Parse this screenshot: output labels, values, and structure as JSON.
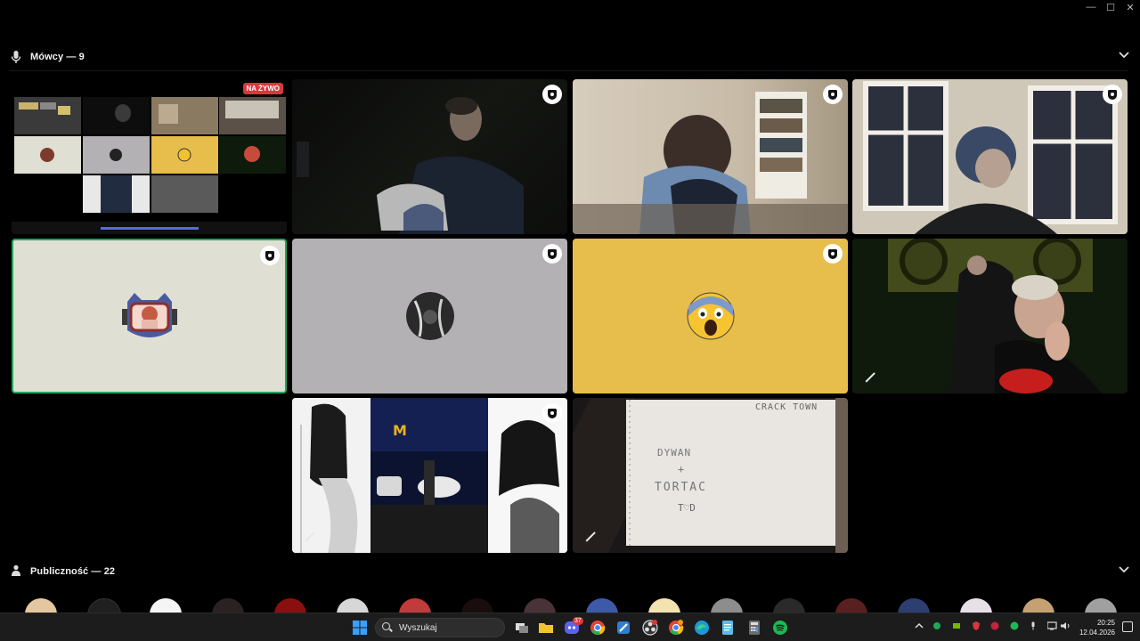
{
  "window": {
    "minimize": "—",
    "maximize": "☐",
    "close": "✕"
  },
  "speakers": {
    "title": "Mówcy — 9",
    "icon": "microphone-icon",
    "collapse_icon": "chevron-down-icon"
  },
  "live_badge": "NA ŻYWO",
  "tiles": [
    {
      "id": "stream-screen",
      "kind": "stream"
    },
    {
      "id": "cam-dark-room",
      "kind": "camera"
    },
    {
      "id": "cam-bookshelf",
      "kind": "camera"
    },
    {
      "id": "cam-window",
      "kind": "camera"
    },
    {
      "id": "avatar-green",
      "kind": "avatar",
      "bg": "#dfdfd3",
      "speaking": true
    },
    {
      "id": "avatar-grey",
      "kind": "avatar",
      "bg": "#b3b1b4"
    },
    {
      "id": "avatar-yellow",
      "kind": "avatar",
      "bg": "#e7be4b",
      "emoji": "😱"
    },
    {
      "id": "cam-cosplay",
      "kind": "camera",
      "muted": true
    },
    {
      "id": "stream-manga",
      "kind": "screen",
      "muted": true
    },
    {
      "id": "cam-paper",
      "kind": "camera",
      "muted": true
    }
  ],
  "paper_note": {
    "header": "CRACK TOWN",
    "line1": "DYWAN",
    "plus": "+",
    "line2": "TORTAC",
    "heart": "T♡D"
  },
  "audience": {
    "title": "Publiczność — 22",
    "icon": "audience-icon",
    "collapse_icon": "chevron-down-icon"
  },
  "taskbar": {
    "search_placeholder": "Wyszukaj",
    "discord_badge": "37",
    "time": "20:25",
    "date": "12.04.2026"
  },
  "colors": {
    "accent_speaking": "#23a55a",
    "live": "#da373c",
    "background": "#000000"
  }
}
